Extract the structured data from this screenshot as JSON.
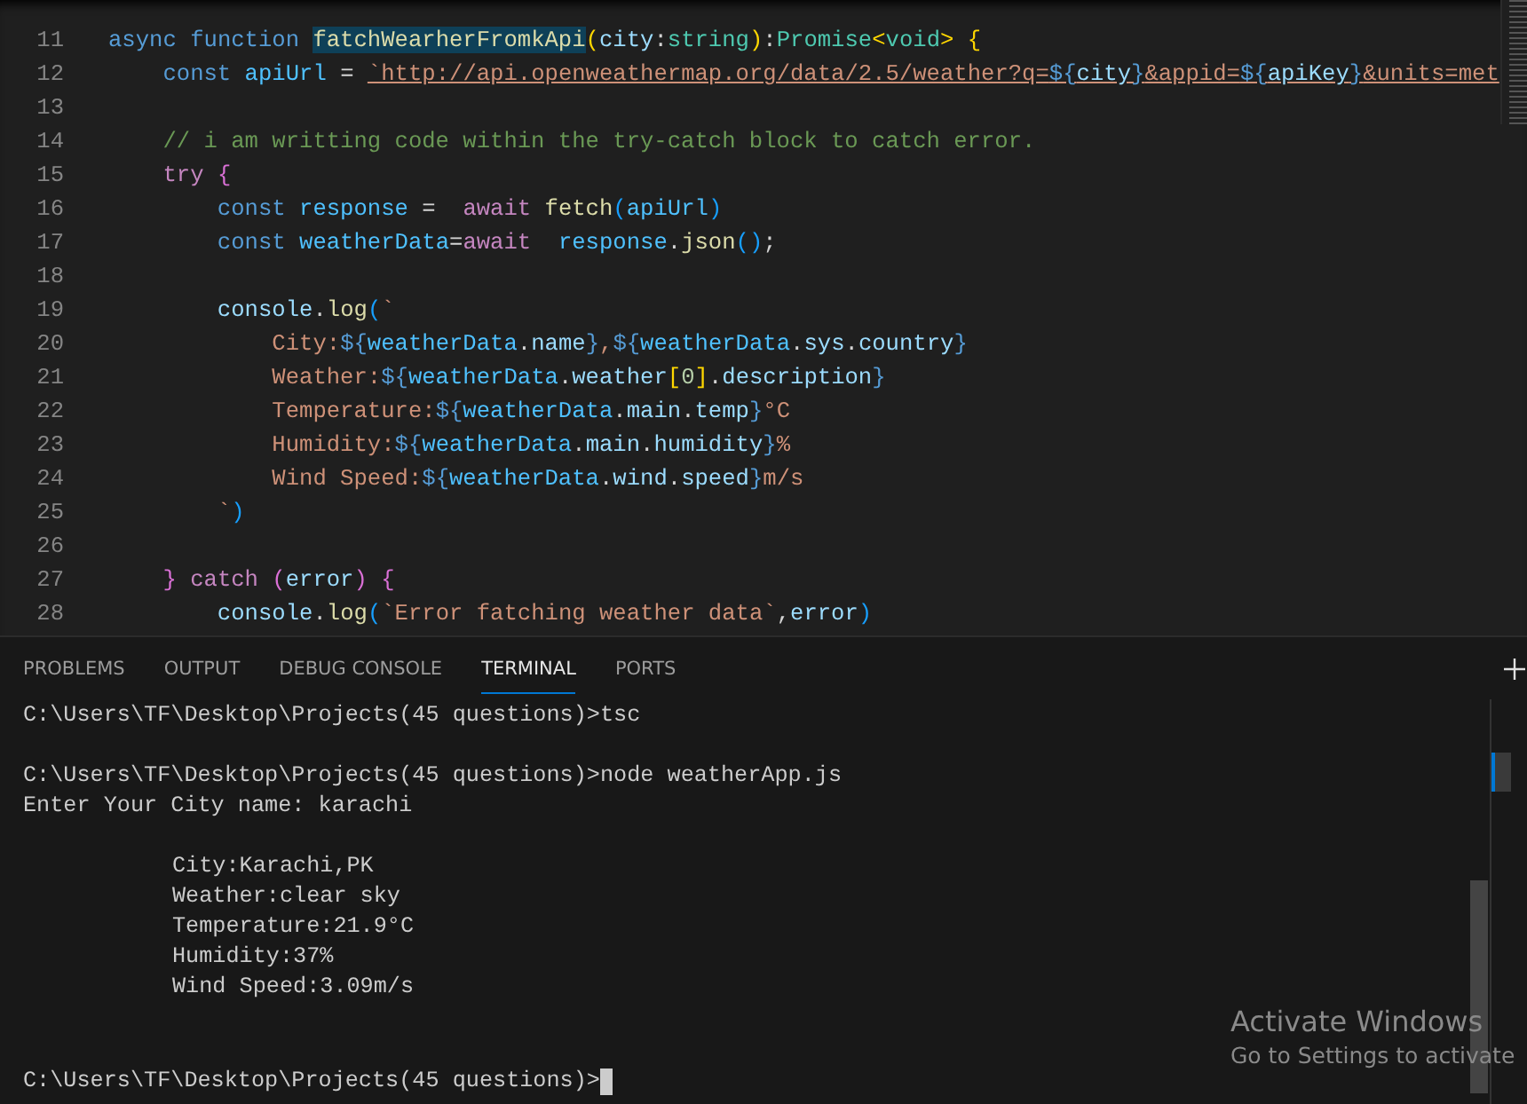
{
  "editor": {
    "lines": [
      {
        "number": "11",
        "tokens": [
          {
            "text": "async",
            "kind": "kw"
          },
          {
            "text": " function ",
            "kind": "kw"
          },
          {
            "text": "fatchWearherFromkApi",
            "kind": "fn",
            "highlighted": true
          },
          {
            "text": "(",
            "kind": "b1"
          },
          {
            "text": "city",
            "kind": "var"
          },
          {
            "text": ":",
            "kind": "pun"
          },
          {
            "text": "string",
            "kind": "type"
          },
          {
            "text": ")",
            "kind": "b1"
          },
          {
            "text": ":",
            "kind": "pun"
          },
          {
            "text": "Promise",
            "kind": "type"
          },
          {
            "text": "<",
            "kind": "b1"
          },
          {
            "text": "void",
            "kind": "type"
          },
          {
            "text": ">",
            "kind": "b1"
          },
          {
            "text": " {",
            "kind": "b1"
          }
        ]
      },
      {
        "number": "12",
        "tokens": [
          {
            "text": "    const",
            "kind": "kw"
          },
          {
            "text": " apiUrl",
            "kind": "const"
          },
          {
            "text": " = ",
            "kind": "pun"
          },
          {
            "text": "`http://api.openweathermap.org/data/2.5/weather?q=",
            "kind": "str",
            "underlined": true
          },
          {
            "text": "${",
            "kind": "tpl",
            "underlined": true
          },
          {
            "text": "city",
            "kind": "var",
            "underlined": true
          },
          {
            "text": "}",
            "kind": "tpl",
            "underlined": true
          },
          {
            "text": "&appid=",
            "kind": "str",
            "underlined": true
          },
          {
            "text": "${",
            "kind": "tpl",
            "underlined": true
          },
          {
            "text": "apiKey",
            "kind": "var",
            "underlined": true
          },
          {
            "text": "}",
            "kind": "tpl",
            "underlined": true
          },
          {
            "text": "&units=met",
            "kind": "str",
            "underlined": true
          }
        ]
      },
      {
        "number": "13"
      },
      {
        "number": "14",
        "tokens": [
          {
            "text": "    // i am writting code within the try-catch block to catch error.",
            "kind": "cmt"
          }
        ]
      },
      {
        "number": "15",
        "tokens": [
          {
            "text": "    try",
            "kind": "ctl"
          },
          {
            "text": " {",
            "kind": "b2"
          }
        ]
      },
      {
        "number": "16",
        "tokens": [
          {
            "text": "        const",
            "kind": "kw"
          },
          {
            "text": " response",
            "kind": "const"
          },
          {
            "text": " =  ",
            "kind": "pun"
          },
          {
            "text": "await",
            "kind": "ctl"
          },
          {
            "text": " fetch",
            "kind": "fn"
          },
          {
            "text": "(",
            "kind": "b3"
          },
          {
            "text": "apiUrl",
            "kind": "const"
          },
          {
            "text": ")",
            "kind": "b3"
          }
        ]
      },
      {
        "number": "17",
        "tokens": [
          {
            "text": "        const",
            "kind": "kw"
          },
          {
            "text": " weatherData",
            "kind": "const"
          },
          {
            "text": "=",
            "kind": "pun"
          },
          {
            "text": "await",
            "kind": "ctl"
          },
          {
            "text": "  response",
            "kind": "const"
          },
          {
            "text": ".",
            "kind": "pun"
          },
          {
            "text": "json",
            "kind": "fn"
          },
          {
            "text": "()",
            "kind": "b3"
          },
          {
            "text": ";",
            "kind": "pun"
          }
        ]
      },
      {
        "number": "18"
      },
      {
        "number": "19",
        "tokens": [
          {
            "text": "        console",
            "kind": "var"
          },
          {
            "text": ".",
            "kind": "pun"
          },
          {
            "text": "log",
            "kind": "fn"
          },
          {
            "text": "(",
            "kind": "b3"
          },
          {
            "text": "`",
            "kind": "str"
          }
        ]
      },
      {
        "number": "20",
        "tokens": [
          {
            "text": "            City:",
            "kind": "str"
          },
          {
            "text": "${",
            "kind": "tpl"
          },
          {
            "text": "weatherData",
            "kind": "const"
          },
          {
            "text": ".",
            "kind": "pun"
          },
          {
            "text": "name",
            "kind": "var"
          },
          {
            "text": "}",
            "kind": "tpl"
          },
          {
            "text": ",",
            "kind": "str"
          },
          {
            "text": "${",
            "kind": "tpl"
          },
          {
            "text": "weatherData",
            "kind": "const"
          },
          {
            "text": ".",
            "kind": "pun"
          },
          {
            "text": "sys",
            "kind": "var"
          },
          {
            "text": ".",
            "kind": "pun"
          },
          {
            "text": "country",
            "kind": "var"
          },
          {
            "text": "}",
            "kind": "tpl"
          }
        ]
      },
      {
        "number": "21",
        "tokens": [
          {
            "text": "            Weather:",
            "kind": "str"
          },
          {
            "text": "${",
            "kind": "tpl"
          },
          {
            "text": "weatherData",
            "kind": "const"
          },
          {
            "text": ".",
            "kind": "pun"
          },
          {
            "text": "weather",
            "kind": "var"
          },
          {
            "text": "[",
            "kind": "b1"
          },
          {
            "text": "0",
            "kind": "num"
          },
          {
            "text": "]",
            "kind": "b1"
          },
          {
            "text": ".",
            "kind": "pun"
          },
          {
            "text": "description",
            "kind": "var"
          },
          {
            "text": "}",
            "kind": "tpl"
          }
        ]
      },
      {
        "number": "22",
        "tokens": [
          {
            "text": "            Temperature:",
            "kind": "str"
          },
          {
            "text": "${",
            "kind": "tpl"
          },
          {
            "text": "weatherData",
            "kind": "const"
          },
          {
            "text": ".",
            "kind": "pun"
          },
          {
            "text": "main",
            "kind": "var"
          },
          {
            "text": ".",
            "kind": "pun"
          },
          {
            "text": "temp",
            "kind": "var"
          },
          {
            "text": "}",
            "kind": "tpl"
          },
          {
            "text": "°C",
            "kind": "str"
          }
        ]
      },
      {
        "number": "23",
        "tokens": [
          {
            "text": "            Humidity:",
            "kind": "str"
          },
          {
            "text": "${",
            "kind": "tpl"
          },
          {
            "text": "weatherData",
            "kind": "const"
          },
          {
            "text": ".",
            "kind": "pun"
          },
          {
            "text": "main",
            "kind": "var"
          },
          {
            "text": ".",
            "kind": "pun"
          },
          {
            "text": "humidity",
            "kind": "var"
          },
          {
            "text": "}",
            "kind": "tpl"
          },
          {
            "text": "%",
            "kind": "str"
          }
        ]
      },
      {
        "number": "24",
        "tokens": [
          {
            "text": "            Wind Speed:",
            "kind": "str"
          },
          {
            "text": "${",
            "kind": "tpl"
          },
          {
            "text": "weatherData",
            "kind": "const"
          },
          {
            "text": ".",
            "kind": "pun"
          },
          {
            "text": "wind",
            "kind": "var"
          },
          {
            "text": ".",
            "kind": "pun"
          },
          {
            "text": "speed",
            "kind": "var"
          },
          {
            "text": "}",
            "kind": "tpl"
          },
          {
            "text": "m/s",
            "kind": "str"
          }
        ]
      },
      {
        "number": "25",
        "tokens": [
          {
            "text": "        `",
            "kind": "str"
          },
          {
            "text": ")",
            "kind": "b3"
          }
        ]
      },
      {
        "number": "26"
      },
      {
        "number": "27",
        "tokens": [
          {
            "text": "    }",
            "kind": "b2"
          },
          {
            "text": " catch",
            "kind": "ctl"
          },
          {
            "text": " (",
            "kind": "b2"
          },
          {
            "text": "error",
            "kind": "var"
          },
          {
            "text": ")",
            "kind": "b2"
          },
          {
            "text": " {",
            "kind": "b2"
          }
        ]
      },
      {
        "number": "28",
        "tokens": [
          {
            "text": "        console",
            "kind": "var"
          },
          {
            "text": ".",
            "kind": "pun"
          },
          {
            "text": "log",
            "kind": "fn"
          },
          {
            "text": "(",
            "kind": "b3"
          },
          {
            "text": "`Error fatching weather data`",
            "kind": "str"
          },
          {
            "text": ",",
            "kind": "pun"
          },
          {
            "text": "error",
            "kind": "var"
          },
          {
            "text": ")",
            "kind": "b3"
          }
        ]
      }
    ]
  },
  "panel": {
    "tabs": [
      {
        "label": "PROBLEMS",
        "selected": false
      },
      {
        "label": "OUTPUT",
        "selected": false
      },
      {
        "label": "DEBUG CONSOLE",
        "selected": false
      },
      {
        "label": "TERMINAL",
        "selected": true
      },
      {
        "label": "PORTS",
        "selected": false
      }
    ],
    "terminal": {
      "blocks": [
        {
          "indented": false,
          "lines": [
            {
              "text": "C:\\Users\\TF\\Desktop\\Projects(45 questions)>tsc",
              "cursor": false
            }
          ]
        },
        {
          "indented": false,
          "lines": [
            {
              "text": "C:\\Users\\TF\\Desktop\\Projects(45 questions)>node weatherApp.js",
              "cursor": false
            },
            {
              "text": "Enter Your City name: karachi",
              "cursor": false
            }
          ]
        },
        {
          "indented": true,
          "lines": [
            {
              "text": "City:Karachi,PK",
              "cursor": false
            },
            {
              "text": "Weather:clear sky",
              "cursor": false
            },
            {
              "text": "Temperature:21.9°C",
              "cursor": false
            },
            {
              "text": "Humidity:37%",
              "cursor": false
            },
            {
              "text": "Wind Speed:3.09m/s",
              "cursor": false
            }
          ]
        },
        {
          "indented": false,
          "lines": [
            {
              "text": "C:\\Users\\TF\\Desktop\\Projects(45 questions)>",
              "cursor": true
            }
          ]
        }
      ]
    }
  },
  "os_notice": {
    "title": "Activate Windows",
    "subtitle": "Go to Settings to activate"
  }
}
